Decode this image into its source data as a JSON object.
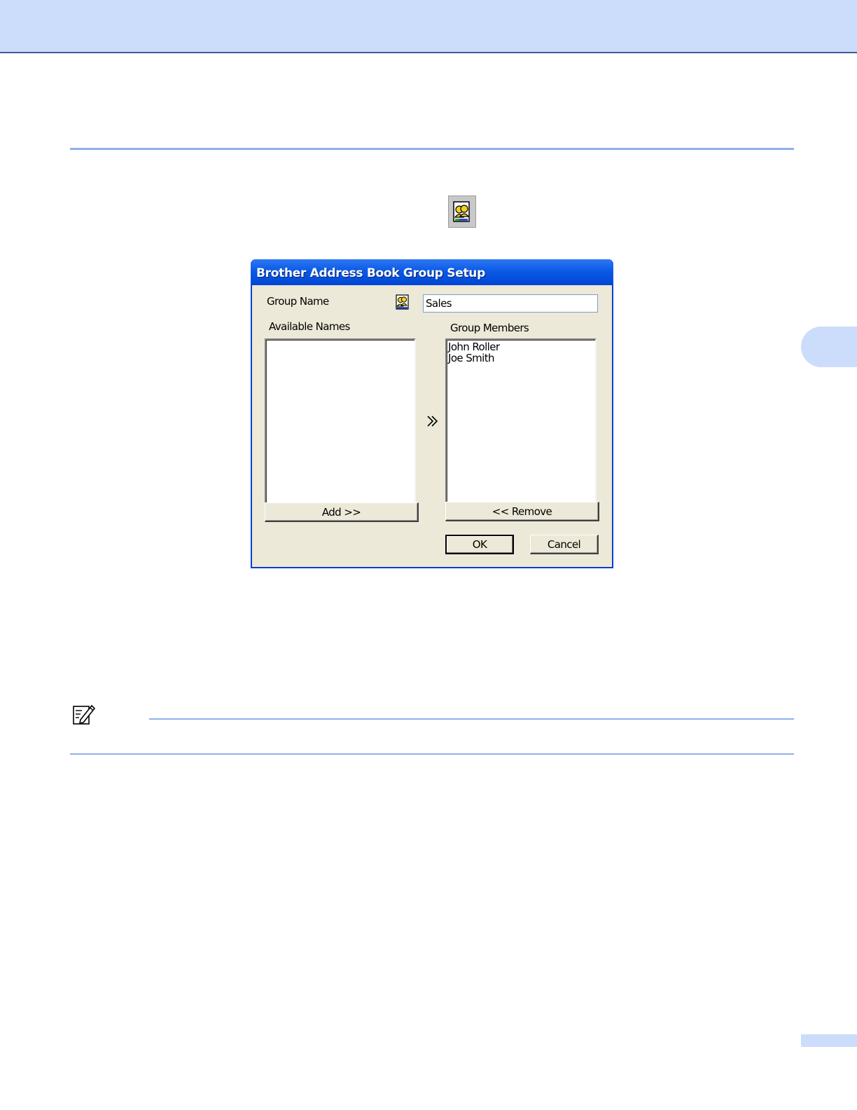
{
  "dialog": {
    "title": "Brother Address Book Group Setup",
    "group_name_label": "Group Name",
    "group_name_value": "Sales",
    "available_names_label": "Available Names",
    "available_names": [],
    "group_members_label": "Group Members",
    "group_members": [
      "John Roller",
      "Joe Smith"
    ],
    "add_button": "Add >>",
    "remove_button": "<< Remove",
    "ok_button": "OK",
    "cancel_button": "Cancel"
  },
  "icons": {
    "toolbar": "address-book-group-icon",
    "group": "group-icon",
    "move": "double-chevron-right-icon",
    "note": "note-pencil-icon"
  },
  "colors": {
    "header_band": "#ccdcfb",
    "rule": "#8fb0ec",
    "titlebar": "#0a5ae6",
    "dialog_bg": "#ece9d8"
  }
}
